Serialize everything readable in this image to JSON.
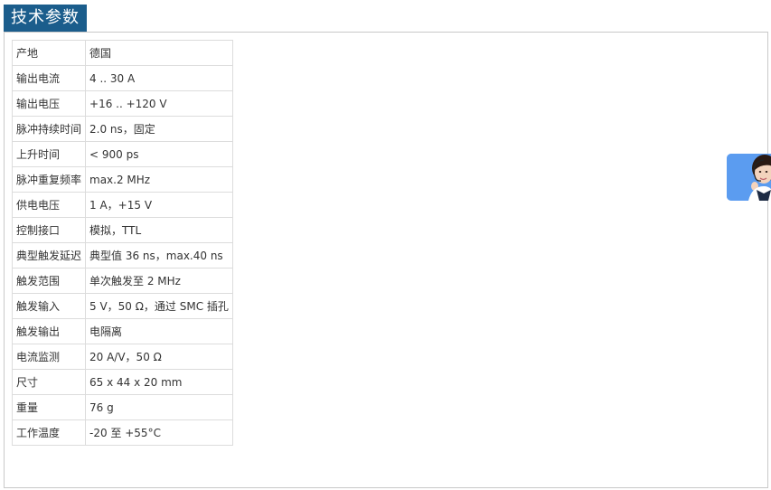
{
  "header": {
    "tab_title": "技术参数"
  },
  "specs": [
    {
      "label": "产地",
      "value": "德国"
    },
    {
      "label": "输出电流",
      "value": "4 .. 30 A"
    },
    {
      "label": "输出电压",
      "value": "+16 .. +120 V"
    },
    {
      "label": "脉冲持续时间",
      "value": "2.0 ns，固定"
    },
    {
      "label": "上升时间",
      "value": "< 900 ps"
    },
    {
      "label": "脉冲重复频率",
      "value": "max.2 MHz"
    },
    {
      "label": "供电电压",
      "value": "1 A，+15 V"
    },
    {
      "label": "控制接口",
      "value": "模拟，TTL"
    },
    {
      "label": "典型触发延迟",
      "value": "典型值 36 ns，max.40 ns"
    },
    {
      "label": "触发范围",
      "value": "单次触发至 2 MHz"
    },
    {
      "label": "触发输入",
      "value": "5 V，50 Ω，通过 SMC 插孔"
    },
    {
      "label": "触发输出",
      "value": "电隔离"
    },
    {
      "label": "电流监测",
      "value": "20 A/V，50 Ω"
    },
    {
      "label": "尺寸",
      "value": "65 x 44 x 20 mm"
    },
    {
      "label": "重量",
      "value": "76 g"
    },
    {
      "label": "工作温度",
      "value": "-20 至 +55°C"
    }
  ],
  "floating_widget": {
    "icon": "customer-service-icon",
    "color": "#5b9cf0"
  }
}
